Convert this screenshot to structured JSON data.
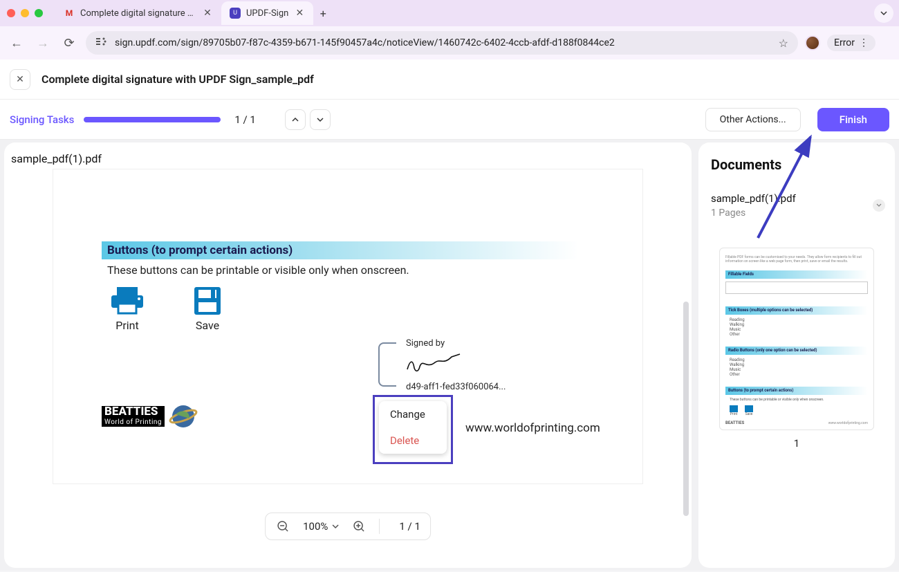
{
  "browser": {
    "tabs": [
      {
        "title": "Complete digital signature wi…",
        "favicon": "M"
      },
      {
        "title": "UPDF-Sign",
        "favicon": "🟣"
      }
    ],
    "url": "sign.updf.com/sign/89705b07-f87c-4359-b671-145f90457a4c/noticeView/1460742c-6402-4ccb-afdf-d188f0844ce2",
    "error_label": "Error"
  },
  "header": {
    "doc_title": "Complete digital signature with UPDF Sign_sample_pdf"
  },
  "taskbar": {
    "label": "Signing Tasks",
    "count": "1 / 1",
    "other_actions": "Other Actions...",
    "finish": "Finish"
  },
  "canvas": {
    "filename": "sample_pdf(1).pdf",
    "section_title": "Buttons (to prompt certain actions)",
    "section_sub": "These buttons can be printable or visible only when onscreen.",
    "print_label": "Print",
    "save_label": "Save",
    "signed_by": "Signed by",
    "sig_id": "d49-aff1-fed33f060064...",
    "menu_change": "Change",
    "menu_delete": "Delete",
    "logo_main": "BEATTIES",
    "logo_sub": "World of Printing",
    "site_url": "www.worldofprinting.com"
  },
  "footer": {
    "zoom": "100%",
    "page": "1 / 1"
  },
  "side": {
    "title": "Documents",
    "file": "sample_pdf(1).pdf",
    "pages": "1 Pages",
    "thumb_num": "1"
  }
}
